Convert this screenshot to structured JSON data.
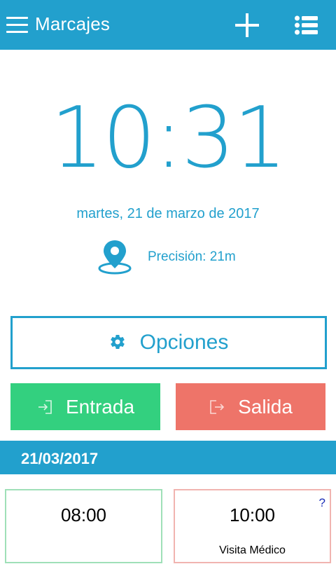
{
  "appbar": {
    "title": "Marcajes",
    "icons": [
      "menu-icon",
      "add-icon",
      "list-icon"
    ],
    "color": "#22a0cd"
  },
  "clock": {
    "time": "10:31",
    "date": "martes, 21 de marzo de 2017",
    "precision": "Precisión: 21m",
    "color": "#22a0cd"
  },
  "options": {
    "label": "Opciones",
    "icon": "gear-icon"
  },
  "actions": {
    "entrada": {
      "label": "Entrada",
      "icon": "sign-in-icon",
      "color": "#33d07f"
    },
    "salida": {
      "label": "Salida",
      "icon": "sign-out-icon",
      "color": "#ee7469"
    }
  },
  "day": {
    "date": "21/03/2017",
    "entries": [
      {
        "time": "08:00",
        "note": "",
        "status_color": "#9fe0b8"
      },
      {
        "time": "10:00",
        "note": "Visita Médico",
        "help": "?",
        "status_color": "#f1b4b0"
      }
    ]
  }
}
